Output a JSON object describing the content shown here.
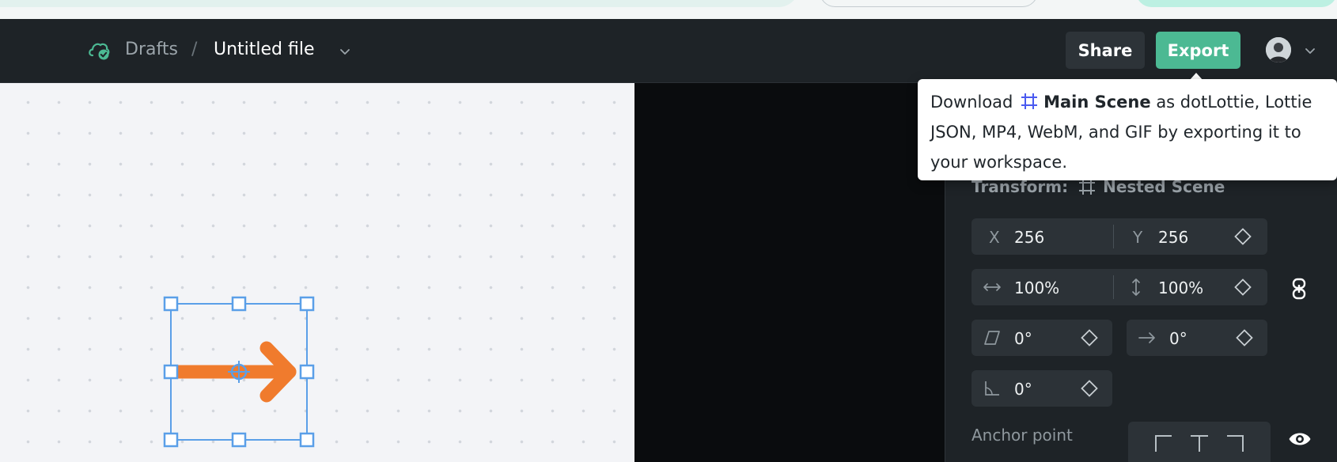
{
  "header": {
    "breadcrumb_root": "Drafts",
    "breadcrumb_separator": "/",
    "file_name": "Untitled file",
    "share_label": "Share",
    "export_label": "Export"
  },
  "tooltip": {
    "prefix": "Download",
    "scene_name": "Main Scene",
    "text_line1_rest": "as dotLottie, Lottie",
    "text_line2": "JSON, MP4, WebM, and GIF by exporting it to",
    "text_line3": "your workspace."
  },
  "panel": {
    "transform_label": "Transform:",
    "transform_target": "Nested Scene",
    "position": {
      "x_label": "X",
      "x_value": "256",
      "y_label": "Y",
      "y_value": "256"
    },
    "scale": {
      "width_value": "100%",
      "height_value": "100%"
    },
    "skew_value": "0°",
    "skew_axis_value": "0°",
    "rotation_value": "0°",
    "anchor_label": "Anchor point"
  },
  "colors": {
    "accent": "#4cb993",
    "selection": "#5a9fe8",
    "arrow": "#f07b2d",
    "scene_icon": "#4a5af0"
  },
  "icons": [
    "cloud-check-icon",
    "chevron-down-icon",
    "frame-icon",
    "keyframe-diamond-icon",
    "link-icon",
    "eye-icon",
    "width-arrows-icon",
    "height-arrows-icon",
    "skew-icon",
    "skew-axis-arrow-icon",
    "rotation-angle-icon",
    "anchor-top-left-icon",
    "anchor-top-center-icon",
    "anchor-top-right-icon"
  ]
}
